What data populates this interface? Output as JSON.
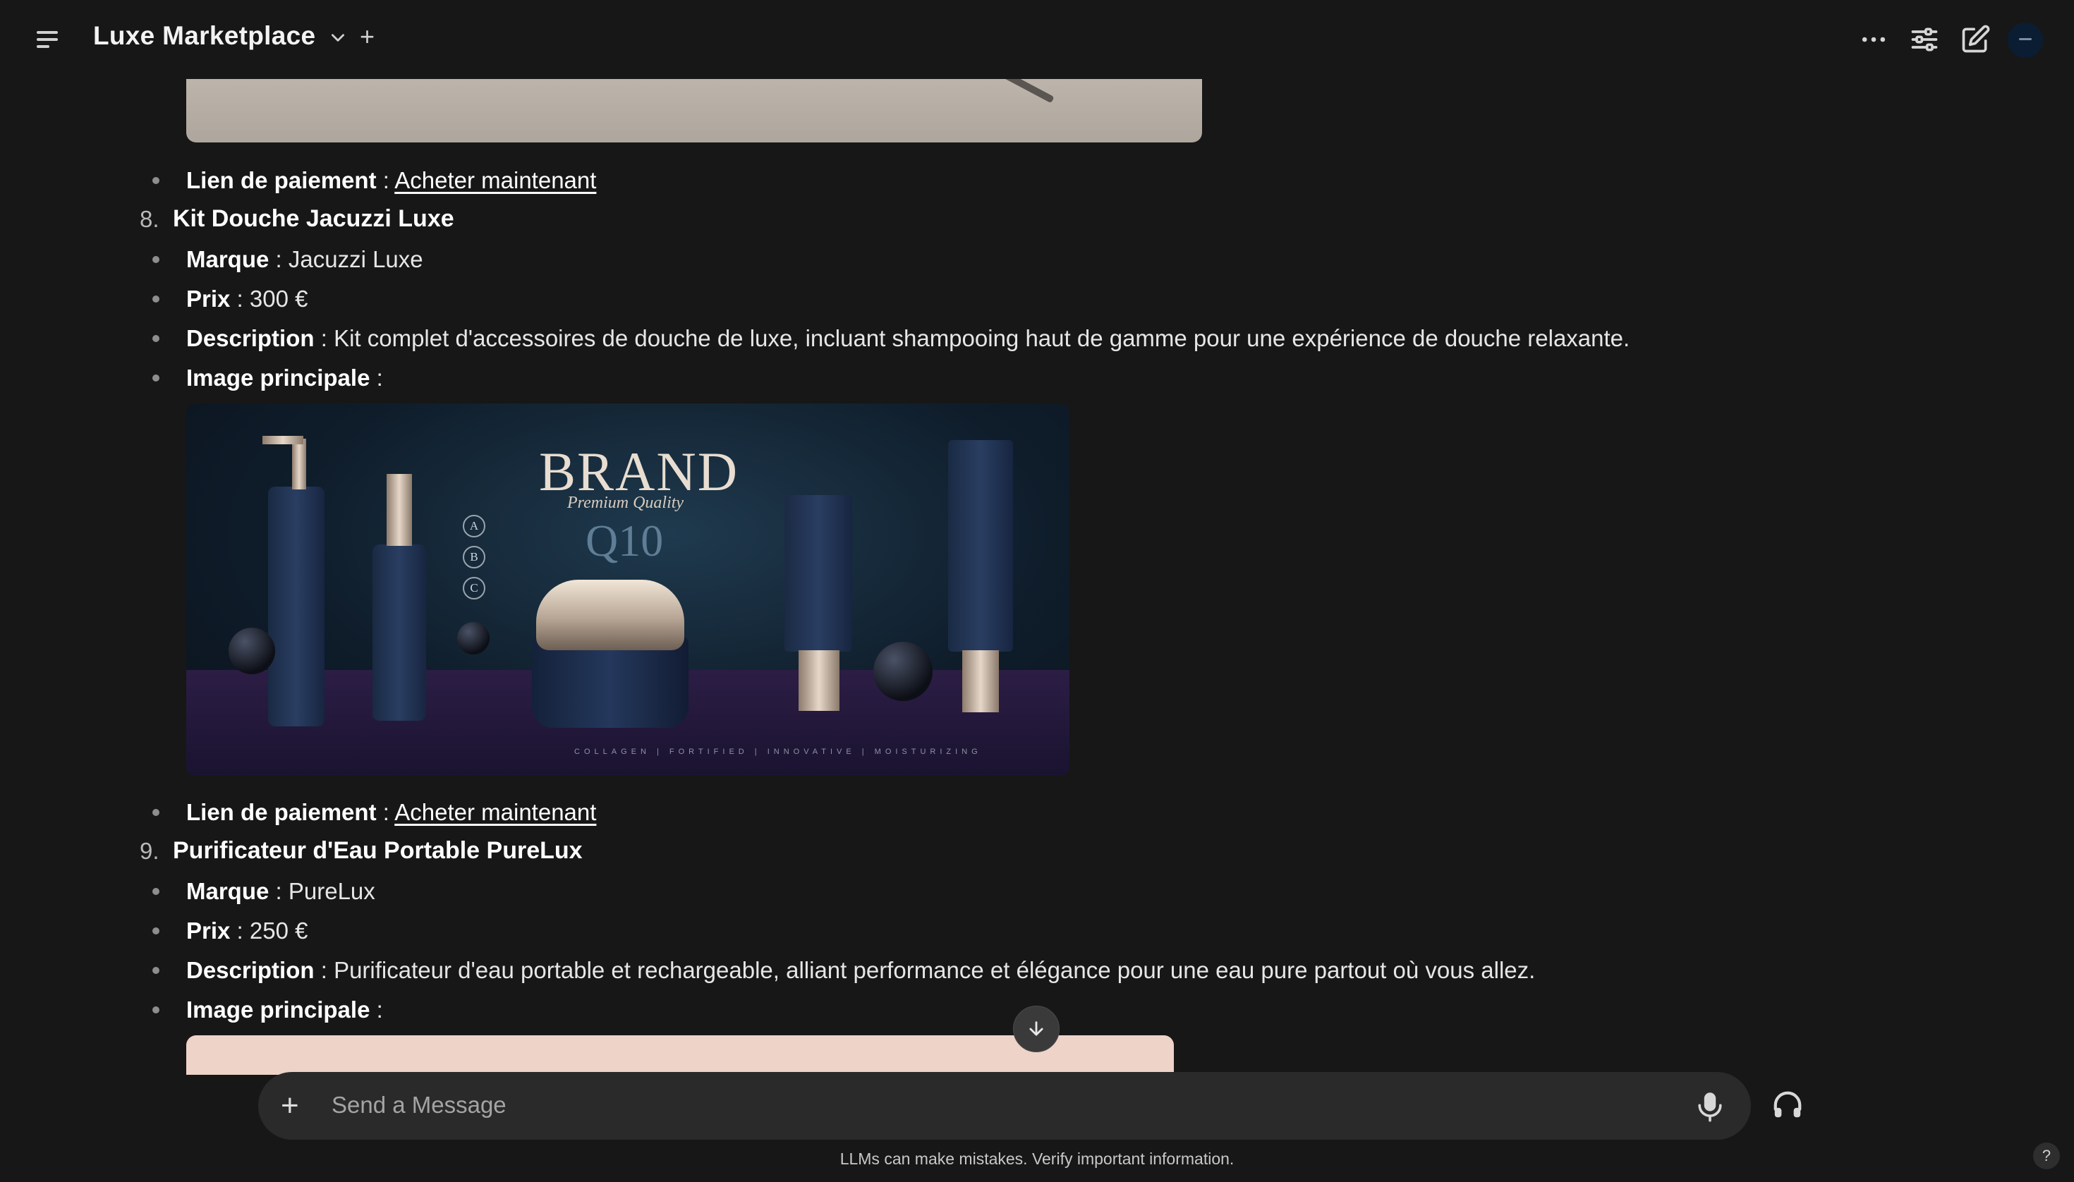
{
  "header": {
    "title": "Luxe Marketplace",
    "new_chat_symbol": "+",
    "icons": [
      "sidebar-menu-icon",
      "chevron-down-icon",
      "more-horizontal-icon",
      "sliders-icon",
      "edit-icon",
      "avatar"
    ]
  },
  "products": [
    {
      "payment_label": "Lien de paiement",
      "payment_link": "Acheter maintenant"
    },
    {
      "number": "8.",
      "name": "Kit Douche Jacuzzi Luxe",
      "brand_label": "Marque",
      "brand": "Jacuzzi Luxe",
      "price_label": "Prix",
      "price": "300 €",
      "description_label": "Description",
      "description": "Kit complet d'accessoires de douche de luxe, incluant shampooing haut de gamme pour une expérience de douche relaxante.",
      "image_label": "Image principale",
      "payment_label": "Lien de paiement",
      "payment_link": "Acheter maintenant",
      "image_text": {
        "brand": "BRAND",
        "tagline": "Premium Quality",
        "model": "Q10",
        "markers": [
          "A",
          "B",
          "C"
        ],
        "tags": "COLLAGEN | FORTIFIED | INNOVATIVE | MOISTURIZING"
      }
    },
    {
      "number": "9.",
      "name": "Purificateur d'Eau Portable PureLux",
      "brand_label": "Marque",
      "brand": "PureLux",
      "price_label": "Prix",
      "price": "250 €",
      "description_label": "Description",
      "description": "Purificateur d'eau portable et rechargeable, alliant performance et élégance pour une eau pure partout où vous allez.",
      "image_label": "Image principale"
    }
  ],
  "separator": " : ",
  "composer": {
    "placeholder": "Send a Message",
    "plus_symbol": "+"
  },
  "disclaimer": "LLMs can make mistakes. Verify important information.",
  "help_symbol": "?",
  "colors": {
    "background": "#171717",
    "input_background": "#2a2a2a",
    "text": "#ececec"
  }
}
